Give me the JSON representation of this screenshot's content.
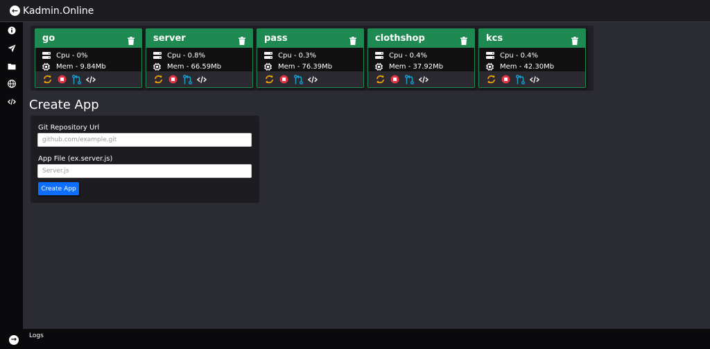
{
  "header": {
    "title": "Kadmin.Online"
  },
  "sidebar": {
    "items": [
      {
        "icon": "info-icon"
      },
      {
        "icon": "send-icon"
      },
      {
        "icon": "folder-icon"
      },
      {
        "icon": "globe-icon"
      },
      {
        "icon": "code-icon"
      }
    ]
  },
  "apps": [
    {
      "name": "go",
      "cpu": "Cpu - 0%",
      "mem": "Mem - 9.84Mb"
    },
    {
      "name": "server",
      "cpu": "Cpu - 0.8%",
      "mem": "Mem - 66.59Mb"
    },
    {
      "name": "pass",
      "cpu": "Cpu - 0.3%",
      "mem": "Mem - 76.39Mb"
    },
    {
      "name": "clothshop",
      "cpu": "Cpu - 0.4%",
      "mem": "Mem - 37.92Mb"
    },
    {
      "name": "kcs",
      "cpu": "Cpu - 0.4%",
      "mem": "Mem - 42.30Mb"
    }
  ],
  "create_app": {
    "title": "Create App",
    "git_label": "Git Repository Url",
    "git_placeholder": "github.com/example.git",
    "file_label": "App File (ex.server.js)",
    "file_placeholder": "Server.js",
    "button_label": "Create App"
  },
  "footer": {
    "logs_label": "Logs"
  },
  "colors": {
    "card_header": "#1e8a51",
    "restart_icon": "#f0a500",
    "stop_icon": "#dc3545",
    "git_icon": "#17a2d8",
    "primary_button": "#0d6efd"
  }
}
